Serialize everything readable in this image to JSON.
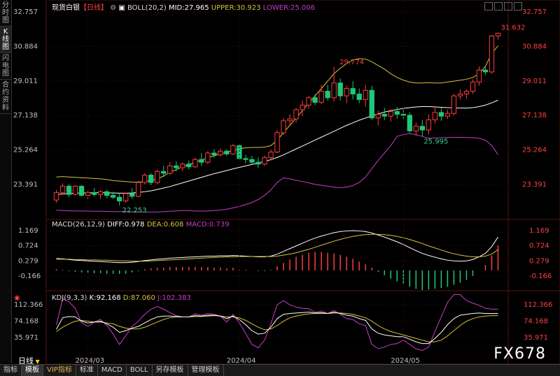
{
  "sidebar": {
    "tabs": [
      {
        "label": "分时图",
        "active": false
      },
      {
        "label": "K线图",
        "active": true
      },
      {
        "label": "闪电图",
        "active": false
      },
      {
        "label": "合约资料",
        "active": false
      }
    ]
  },
  "header": {
    "title": "现货白银",
    "period": "【日线】",
    "boll": "BOLL(20,2)",
    "mid": "MID:27.965",
    "upper": "UPPER:30.923",
    "lower": "LOWER:25.006"
  },
  "macd_header": {
    "name": "MACD(26,12,9)",
    "diff": "DIFF:0.978",
    "dea": "DEA:0.608",
    "macd": "MACD:0.739"
  },
  "kdj_header": {
    "name": "KDJ(9,3,3)",
    "k": "K:92.168",
    "d": "D:87.060",
    "j": "J:102.383"
  },
  "period_label": "日线",
  "watermark": "FX678",
  "bottom_tabs": [
    "指标",
    "模板",
    "VIP指标",
    "标准",
    "MACD",
    "BOLL",
    "另存模板",
    "管理模板"
  ],
  "colors": {
    "up": "#ff3c3c",
    "down": "#1ec878",
    "mid": "#ffffff",
    "upper": "#d4c43c",
    "lower": "#c83cc8",
    "price_label": "#ff4040",
    "low_label": "#30d090"
  },
  "chart_data": {
    "type": "candlestick",
    "price_ticks": [
      "32.757",
      "30.884",
      "29.011",
      "27.138",
      "25.264",
      "23.391"
    ],
    "macd_ticks": [
      "1.169",
      "0.724",
      "0.279",
      "-0.166"
    ],
    "kdj_ticks": [
      "112.366",
      "74.168",
      "35.971"
    ],
    "date_labels": [
      "2024/03",
      "2024/04",
      "2024/05"
    ],
    "annotations": {
      "high": "29.774",
      "last_high": "31.632",
      "low1": "22.253",
      "low2": "25.995"
    },
    "candles": [
      [
        22.55,
        23.1,
        22.4,
        22.95
      ],
      [
        22.95,
        23.45,
        22.85,
        23.3
      ],
      [
        23.3,
        23.4,
        22.7,
        22.85
      ],
      [
        22.85,
        23.35,
        22.8,
        23.3
      ],
      [
        23.3,
        23.35,
        22.75,
        22.8
      ],
      [
        22.8,
        23.05,
        22.6,
        22.95
      ],
      [
        22.95,
        23.2,
        22.75,
        22.85
      ],
      [
        22.85,
        23.1,
        22.6,
        23.0
      ],
      [
        23.0,
        23.1,
        22.65,
        22.8
      ],
      [
        22.8,
        23.0,
        22.6,
        22.7
      ],
      [
        22.7,
        22.95,
        22.25,
        22.5
      ],
      [
        22.5,
        22.95,
        22.4,
        22.9
      ],
      [
        22.9,
        23.2,
        22.6,
        22.75
      ],
      [
        22.75,
        23.6,
        22.7,
        23.5
      ],
      [
        23.5,
        24.0,
        23.4,
        23.9
      ],
      [
        23.9,
        24.0,
        23.35,
        23.5
      ],
      [
        23.5,
        24.2,
        23.4,
        24.1
      ],
      [
        24.1,
        24.4,
        23.8,
        24.0
      ],
      [
        24.0,
        24.6,
        23.9,
        24.4
      ],
      [
        24.4,
        24.65,
        24.1,
        24.3
      ],
      [
        24.3,
        24.6,
        24.1,
        24.5
      ],
      [
        24.5,
        24.7,
        24.2,
        24.35
      ],
      [
        24.35,
        24.85,
        24.3,
        24.75
      ],
      [
        24.75,
        25.1,
        24.4,
        24.6
      ],
      [
        24.6,
        25.2,
        24.5,
        25.1
      ],
      [
        25.1,
        25.3,
        24.85,
        25.0
      ],
      [
        25.0,
        25.35,
        24.9,
        25.2
      ],
      [
        25.2,
        25.3,
        24.95,
        25.05
      ],
      [
        25.05,
        25.6,
        25.0,
        25.5
      ],
      [
        25.5,
        25.55,
        24.75,
        24.8
      ],
      [
        24.8,
        25.0,
        24.55,
        24.75
      ],
      [
        24.75,
        24.95,
        24.5,
        24.6
      ],
      [
        24.6,
        24.85,
        24.3,
        24.5
      ],
      [
        24.5,
        24.95,
        24.4,
        24.85
      ],
      [
        24.85,
        25.3,
        24.7,
        25.15
      ],
      [
        25.15,
        26.35,
        25.1,
        26.2
      ],
      [
        26.2,
        27.0,
        26.1,
        26.85
      ],
      [
        26.85,
        27.2,
        26.55,
        26.95
      ],
      [
        26.95,
        27.55,
        26.75,
        27.45
      ],
      [
        27.45,
        27.95,
        27.1,
        27.7
      ],
      [
        27.7,
        28.2,
        27.5,
        28.1
      ],
      [
        28.1,
        28.3,
        27.7,
        27.85
      ],
      [
        27.85,
        28.8,
        27.75,
        28.45
      ],
      [
        28.45,
        28.8,
        27.95,
        28.1
      ],
      [
        28.1,
        29.77,
        27.9,
        28.9
      ],
      [
        28.9,
        29.15,
        27.95,
        28.2
      ],
      [
        28.2,
        28.75,
        27.8,
        28.6
      ],
      [
        28.6,
        29.0,
        28.0,
        28.3
      ],
      [
        28.3,
        28.6,
        27.8,
        28.0
      ],
      [
        28.0,
        28.8,
        27.6,
        28.5
      ],
      [
        28.5,
        28.75,
        26.9,
        27.0
      ],
      [
        27.0,
        27.4,
        26.6,
        27.2
      ],
      [
        27.2,
        27.55,
        26.9,
        27.1
      ],
      [
        27.1,
        27.45,
        26.8,
        27.35
      ],
      [
        27.35,
        27.6,
        26.95,
        27.2
      ],
      [
        27.2,
        27.5,
        26.9,
        27.15
      ],
      [
        27.15,
        27.3,
        26.2,
        26.3
      ],
      [
        26.3,
        26.75,
        26.0,
        26.55
      ],
      [
        26.55,
        26.9,
        25.99,
        26.35
      ],
      [
        26.35,
        27.2,
        26.1,
        26.9
      ],
      [
        26.9,
        27.6,
        26.7,
        27.3
      ],
      [
        27.3,
        27.55,
        26.85,
        27.1
      ],
      [
        27.1,
        27.45,
        26.95,
        27.25
      ],
      [
        27.25,
        28.3,
        27.15,
        28.2
      ],
      [
        28.2,
        28.55,
        28.0,
        28.3
      ],
      [
        28.3,
        28.55,
        28.05,
        28.45
      ],
      [
        28.45,
        29.1,
        28.3,
        28.95
      ],
      [
        28.95,
        29.8,
        28.75,
        29.6
      ],
      [
        29.6,
        29.8,
        29.35,
        29.5
      ],
      [
        29.5,
        31.5,
        29.4,
        31.45
      ],
      [
        31.45,
        31.63,
        31.25,
        31.6
      ]
    ],
    "boll_upper": [
      23.8,
      23.82,
      23.8,
      23.78,
      23.76,
      23.74,
      23.72,
      23.7,
      23.66,
      23.6,
      23.58,
      23.55,
      23.52,
      23.52,
      23.55,
      23.6,
      23.7,
      23.85,
      24.05,
      24.2,
      24.35,
      24.48,
      24.6,
      24.72,
      24.85,
      24.95,
      25.05,
      25.15,
      25.25,
      25.32,
      25.38,
      25.4,
      25.4,
      25.42,
      25.5,
      25.8,
      26.2,
      26.6,
      27.0,
      27.4,
      27.8,
      28.2,
      28.6,
      29.0,
      29.4,
      29.7,
      29.95,
      30.15,
      30.22,
      30.2,
      30.05,
      29.85,
      29.65,
      29.4,
      29.2,
      29.05,
      28.95,
      28.9,
      28.9,
      28.92,
      28.9,
      28.9,
      28.95,
      29.0,
      29.05,
      29.1,
      29.2,
      29.4,
      29.8,
      30.5,
      30.92
    ],
    "boll_mid": [
      22.85,
      22.88,
      22.9,
      22.92,
      22.93,
      22.94,
      22.95,
      22.95,
      22.94,
      22.93,
      22.92,
      22.92,
      22.93,
      22.96,
      23.0,
      23.05,
      23.12,
      23.2,
      23.28,
      23.38,
      23.48,
      23.58,
      23.68,
      23.78,
      23.88,
      23.98,
      24.06,
      24.15,
      24.24,
      24.32,
      24.4,
      24.48,
      24.56,
      24.64,
      24.74,
      24.86,
      25.0,
      25.16,
      25.32,
      25.48,
      25.64,
      25.8,
      25.96,
      26.12,
      26.28,
      26.44,
      26.6,
      26.74,
      26.88,
      27.0,
      27.12,
      27.22,
      27.32,
      27.4,
      27.46,
      27.52,
      27.56,
      27.6,
      27.62,
      27.62,
      27.6,
      27.58,
      27.56,
      27.55,
      27.54,
      27.54,
      27.56,
      27.62,
      27.7,
      27.82,
      27.97
    ],
    "boll_lower": [
      22.0,
      21.98,
      21.96,
      21.96,
      21.95,
      21.95,
      21.94,
      21.94,
      21.93,
      21.92,
      21.92,
      21.92,
      21.91,
      21.91,
      21.9,
      21.9,
      21.9,
      21.92,
      21.94,
      21.96,
      21.98,
      21.98,
      21.95,
      21.95,
      21.95,
      21.98,
      22.0,
      22.05,
      22.12,
      22.2,
      22.3,
      22.42,
      22.58,
      22.8,
      23.1,
      23.5,
      23.75,
      23.7,
      23.62,
      23.55,
      23.48,
      23.4,
      23.35,
      23.3,
      23.25,
      23.22,
      23.25,
      23.34,
      23.5,
      23.8,
      24.25,
      24.7,
      25.1,
      25.5,
      26.0,
      26.1,
      26.15,
      26.1,
      26.0,
      25.9,
      25.92,
      25.93,
      25.94,
      25.95,
      25.95,
      25.94,
      25.93,
      25.9,
      25.8,
      25.5,
      25.01
    ],
    "macd_diff": [
      0.35,
      0.34,
      0.32,
      0.3,
      0.29,
      0.28,
      0.27,
      0.26,
      0.25,
      0.24,
      0.23,
      0.23,
      0.24,
      0.26,
      0.29,
      0.31,
      0.33,
      0.34,
      0.36,
      0.37,
      0.38,
      0.39,
      0.4,
      0.41,
      0.42,
      0.42,
      0.43,
      0.43,
      0.44,
      0.43,
      0.42,
      0.41,
      0.4,
      0.4,
      0.42,
      0.48,
      0.56,
      0.64,
      0.72,
      0.8,
      0.88,
      0.95,
      1.01,
      1.06,
      1.11,
      1.14,
      1.16,
      1.17,
      1.16,
      1.14,
      1.1,
      1.04,
      0.98,
      0.91,
      0.84,
      0.76,
      0.67,
      0.58,
      0.5,
      0.44,
      0.39,
      0.34,
      0.3,
      0.28,
      0.27,
      0.28,
      0.32,
      0.4,
      0.5,
      0.7,
      0.98
    ],
    "macd_dea": [
      0.33,
      0.33,
      0.33,
      0.32,
      0.32,
      0.31,
      0.31,
      0.3,
      0.3,
      0.29,
      0.28,
      0.28,
      0.27,
      0.27,
      0.27,
      0.28,
      0.29,
      0.3,
      0.31,
      0.32,
      0.33,
      0.34,
      0.35,
      0.36,
      0.37,
      0.38,
      0.39,
      0.4,
      0.4,
      0.41,
      0.41,
      0.41,
      0.41,
      0.41,
      0.41,
      0.42,
      0.45,
      0.48,
      0.52,
      0.57,
      0.62,
      0.68,
      0.74,
      0.8,
      0.86,
      0.91,
      0.96,
      1.0,
      1.03,
      1.05,
      1.06,
      1.06,
      1.05,
      1.03,
      1.0,
      0.96,
      0.91,
      0.85,
      0.79,
      0.72,
      0.66,
      0.6,
      0.54,
      0.49,
      0.45,
      0.42,
      0.4,
      0.4,
      0.42,
      0.48,
      0.61
    ],
    "macd_hist": [
      0.04,
      0.02,
      -0.02,
      -0.04,
      -0.06,
      -0.06,
      -0.08,
      -0.08,
      -0.1,
      -0.1,
      -0.1,
      -0.1,
      -0.06,
      -0.02,
      0.04,
      0.06,
      0.08,
      0.08,
      0.1,
      0.1,
      0.1,
      0.1,
      0.1,
      0.1,
      0.1,
      0.08,
      0.08,
      0.06,
      0.08,
      0.04,
      0.02,
      0.0,
      -0.02,
      -0.02,
      0.02,
      0.12,
      0.22,
      0.32,
      0.4,
      0.46,
      0.52,
      0.54,
      0.54,
      0.52,
      0.5,
      0.46,
      0.4,
      0.34,
      0.26,
      0.18,
      0.08,
      -0.04,
      -0.14,
      -0.24,
      -0.32,
      -0.4,
      -0.48,
      -0.54,
      -0.58,
      -0.56,
      -0.54,
      -0.52,
      -0.48,
      -0.42,
      -0.36,
      -0.28,
      -0.16,
      0.0,
      0.16,
      0.44,
      0.74
    ],
    "kdj_k": [
      55,
      82,
      85,
      84,
      74,
      70,
      72,
      74,
      68,
      60,
      48,
      52,
      58,
      62,
      70,
      78,
      84,
      86,
      86,
      85,
      84,
      84,
      87,
      86,
      88,
      88,
      86,
      80,
      86,
      78,
      66,
      52,
      44,
      46,
      60,
      80,
      90,
      92,
      93,
      94,
      95,
      93,
      94,
      92,
      95,
      92,
      88,
      86,
      80,
      76,
      56,
      46,
      42,
      40,
      38,
      38,
      32,
      26,
      22,
      22,
      34,
      48,
      66,
      80,
      88,
      90,
      92,
      93,
      92,
      92,
      92
    ],
    "kdj_d": [
      50,
      60,
      68,
      74,
      76,
      74,
      72,
      72,
      70,
      68,
      62,
      58,
      56,
      56,
      60,
      66,
      72,
      78,
      82,
      84,
      84,
      84,
      85,
      85,
      86,
      87,
      86,
      84,
      84,
      82,
      76,
      68,
      60,
      54,
      56,
      64,
      74,
      82,
      86,
      89,
      91,
      92,
      92,
      92,
      93,
      93,
      92,
      90,
      86,
      82,
      74,
      64,
      56,
      50,
      46,
      42,
      38,
      34,
      30,
      26,
      26,
      30,
      40,
      52,
      64,
      74,
      80,
      84,
      86,
      87,
      87
    ],
    "kdj_j": [
      65,
      126,
      119,
      104,
      70,
      62,
      72,
      78,
      64,
      44,
      20,
      40,
      62,
      74,
      90,
      102,
      108,
      102,
      94,
      87,
      84,
      84,
      91,
      88,
      92,
      90,
      86,
      72,
      90,
      70,
      46,
      20,
      12,
      30,
      68,
      112,
      122,
      112,
      107,
      104,
      103,
      95,
      98,
      92,
      99,
      90,
      80,
      78,
      68,
      64,
      20,
      10,
      14,
      20,
      22,
      30,
      20,
      10,
      6,
      14,
      50,
      84,
      118,
      136,
      136,
      122,
      116,
      111,
      104,
      102,
      102
    ]
  }
}
